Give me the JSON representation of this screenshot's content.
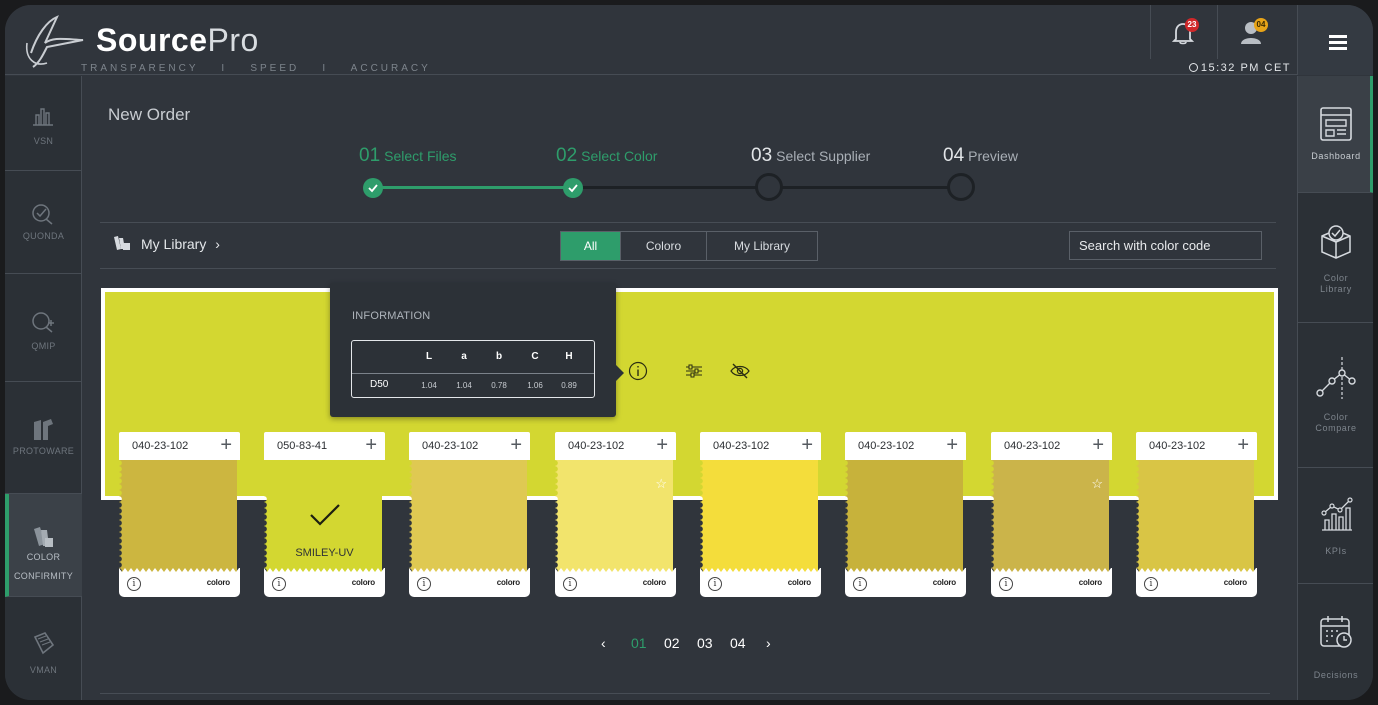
{
  "header": {
    "brand_bold": "Source",
    "brand_light": "Pro",
    "tagline": "TRANSPARENCY    I    SPEED    I    ACCURACY",
    "clock": "15:32 PM CET",
    "notifications_count": "23",
    "user_count": "04"
  },
  "left_nav": {
    "items": [
      {
        "label": "VSN",
        "icon": "bar-chart-icon"
      },
      {
        "label": "QUONDA",
        "icon": "quality-check-icon"
      },
      {
        "label": "QMIP",
        "icon": "search-plus-icon"
      },
      {
        "label": "PROTOWARE",
        "icon": "garment-icon"
      },
      {
        "label": "COLOR",
        "label2": "CONFIRMITY",
        "icon": "color-swatch-icon",
        "active": true
      },
      {
        "label": "VMAN",
        "icon": "fabric-icon"
      }
    ]
  },
  "right_nav": {
    "items": [
      {
        "label": "Dashboard",
        "icon": "dashboard-icon",
        "active": true
      },
      {
        "label": "Color",
        "label2": "Library",
        "icon": "box-check-icon"
      },
      {
        "label": "Color",
        "label2": "Compare",
        "icon": "compare-graph-icon"
      },
      {
        "label": "KPIs",
        "icon": "kpi-chart-icon"
      },
      {
        "label": "Decisions",
        "icon": "calendar-clock-icon"
      }
    ]
  },
  "page": {
    "title": "New Order"
  },
  "steps": [
    {
      "num": "01",
      "label": "Select Files",
      "state": "done"
    },
    {
      "num": "02",
      "label": "Select Color",
      "state": "done"
    },
    {
      "num": "03",
      "label": "Select Supplier",
      "state": "todo"
    },
    {
      "num": "04",
      "label": "Preview",
      "state": "todo"
    }
  ],
  "library": {
    "breadcrumb": "My Library",
    "breadcrumb_chevron": "›",
    "filters": [
      "All",
      "Coloro",
      "My Library"
    ],
    "active_filter": "All",
    "search_placeholder": "Search with color code"
  },
  "selected_color": {
    "hex": "#d3d731"
  },
  "info_popover": {
    "title": "INFORMATION",
    "columns": [
      "L",
      "a",
      "b",
      "C",
      "H"
    ],
    "row_label": "D50",
    "values": [
      "1.04",
      "1.04",
      "0.78",
      "1.06",
      "0.89"
    ]
  },
  "cards": [
    {
      "code": "040-23-102",
      "color": "#ccb640",
      "brand": "coloro",
      "star": false,
      "selected": false,
      "name": ""
    },
    {
      "code": "050-83-41",
      "color": "#d3d731",
      "brand": "coloro",
      "star": false,
      "selected": true,
      "name": "SMILEY-UV"
    },
    {
      "code": "040-23-102",
      "color": "#dfc952",
      "brand": "coloro",
      "star": false,
      "selected": false,
      "name": ""
    },
    {
      "code": "040-23-102",
      "color": "#f2e46c",
      "brand": "coloro",
      "star": true,
      "selected": false,
      "name": ""
    },
    {
      "code": "040-23-102",
      "color": "#f4dd3b",
      "brand": "coloro",
      "star": false,
      "selected": false,
      "name": ""
    },
    {
      "code": "040-23-102",
      "color": "#c7b23b",
      "brand": "coloro",
      "star": false,
      "selected": false,
      "name": ""
    },
    {
      "code": "040-23-102",
      "color": "#cbb44a",
      "brand": "coloro",
      "star": true,
      "selected": false,
      "name": ""
    },
    {
      "code": "040-23-102",
      "color": "#d9c545",
      "brand": "coloro",
      "star": false,
      "selected": false,
      "name": ""
    }
  ],
  "pager": {
    "prev": "‹",
    "pages": [
      "01",
      "02",
      "03",
      "04"
    ],
    "current": "01",
    "next": "›"
  },
  "colors": {
    "accent": "#2e9d6b",
    "background": "#30353c"
  }
}
